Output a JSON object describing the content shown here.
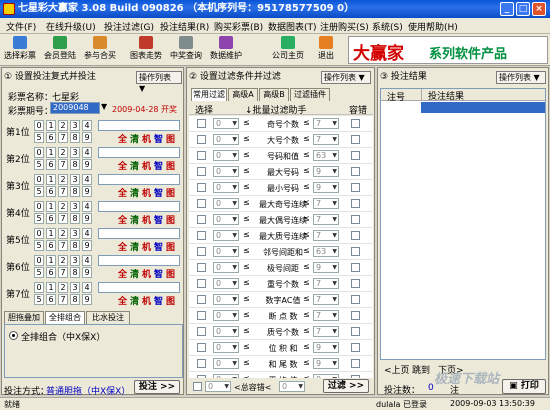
{
  "window": {
    "title": "七星彩大赢家 3.08 Build 090826 （本机序列号：95178577509 0）",
    "minimize": "_",
    "maximize": "□",
    "close": "×"
  },
  "menu": [
    "文件(F)",
    "在线升级(U)",
    "投注过滤(G)",
    "投注结果(R)",
    "购买彩票(B)",
    "数据图表(T)",
    "注册购买(S)",
    "系统(S)",
    "使用帮助(H)"
  ],
  "toolbar": [
    "选择彩票",
    "会员登陆",
    "参与合买",
    "图表走势",
    "中奖查询",
    "数据维护",
    "公司主页",
    "退出"
  ],
  "banner": {
    "main": "大赢家",
    "sub": "系列软件产品"
  },
  "left": {
    "heading": "① 设置投注复式并投注",
    "dropdown": "操作列表",
    "lottery_label": "彩票名称：",
    "lottery_name": "七星彩",
    "period_label": "彩票期号：",
    "period_value": "2009048",
    "date": "2009-04-28 开奖",
    "digit_rows": [
      "第1位",
      "第2位",
      "第3位",
      "第4位",
      "第5位",
      "第6位",
      "第7位"
    ],
    "row_top": [
      "0",
      "1",
      "2",
      "3",
      "4"
    ],
    "row_bottom": [
      "5",
      "6",
      "7",
      "8",
      "9"
    ],
    "quick": [
      "全",
      "清",
      "机",
      "智",
      "图"
    ],
    "tabs": [
      "胆拖叠加",
      "全排组合",
      "比水投注"
    ],
    "radio_label": "全排组合（中X保X）",
    "bet_mode_label": "投注方式：",
    "bet_mode_value": "普通胆拖（中X保X）",
    "bet_button": "投注 >>"
  },
  "mid": {
    "heading": "② 设置过滤条件并过滤",
    "dropdown": "操作列表",
    "tabs": [
      "常用过滤",
      "高级A",
      "高级B",
      "过滤插件"
    ],
    "col_select": "选择",
    "col_batch": "↓批量过滤助手",
    "col_tolerance": "容错",
    "filters": [
      {
        "lo": "0",
        "name": "奇号个数",
        "hi": "7"
      },
      {
        "lo": "0",
        "name": "大号个数",
        "hi": "7"
      },
      {
        "lo": "0",
        "name": "号码和值",
        "hi": "63"
      },
      {
        "lo": "0",
        "name": "最大号码",
        "hi": "9"
      },
      {
        "lo": "0",
        "name": "最小号码",
        "hi": "9"
      },
      {
        "lo": "0",
        "name": "最大奇号连续",
        "hi": "7"
      },
      {
        "lo": "0",
        "name": "最大偶号连续",
        "hi": "7"
      },
      {
        "lo": "0",
        "name": "最大质号连续",
        "hi": "7"
      },
      {
        "lo": "0",
        "name": "邻号间距和",
        "hi": "63"
      },
      {
        "lo": "0",
        "name": "极号间距",
        "hi": "9"
      },
      {
        "lo": "0",
        "name": "重号个数",
        "hi": "7"
      },
      {
        "lo": "0",
        "name": "数字AC值",
        "hi": "7"
      },
      {
        "lo": "0",
        "name": "断 点 数",
        "hi": "7"
      },
      {
        "lo": "0",
        "name": "质号个数",
        "hi": "7"
      },
      {
        "lo": "0",
        "name": "位 积 和",
        "hi": "9"
      },
      {
        "lo": "0",
        "name": "和 尾 数",
        "hi": "9"
      },
      {
        "lo": "0",
        "name": "平 均 值",
        "hi": "9"
      }
    ],
    "footer_lo": "0",
    "footer_label": "<总容错<",
    "footer_hi": "0",
    "filter_button": "过滤 >>"
  },
  "right": {
    "heading": "③ 投注结果",
    "dropdown": "操作列表",
    "col_no": "注号",
    "col_result": "投注结果",
    "nav": [
      "<上页",
      "跳到",
      "下页>"
    ],
    "count_label": "投注数：",
    "count_value": "0",
    "count_unit": "注",
    "print_button": "打印"
  },
  "status": {
    "ready": "就绪",
    "user": "dulala 已登录",
    "time": "2009-09-03 13:50:39"
  },
  "watermark": "极速下载站"
}
